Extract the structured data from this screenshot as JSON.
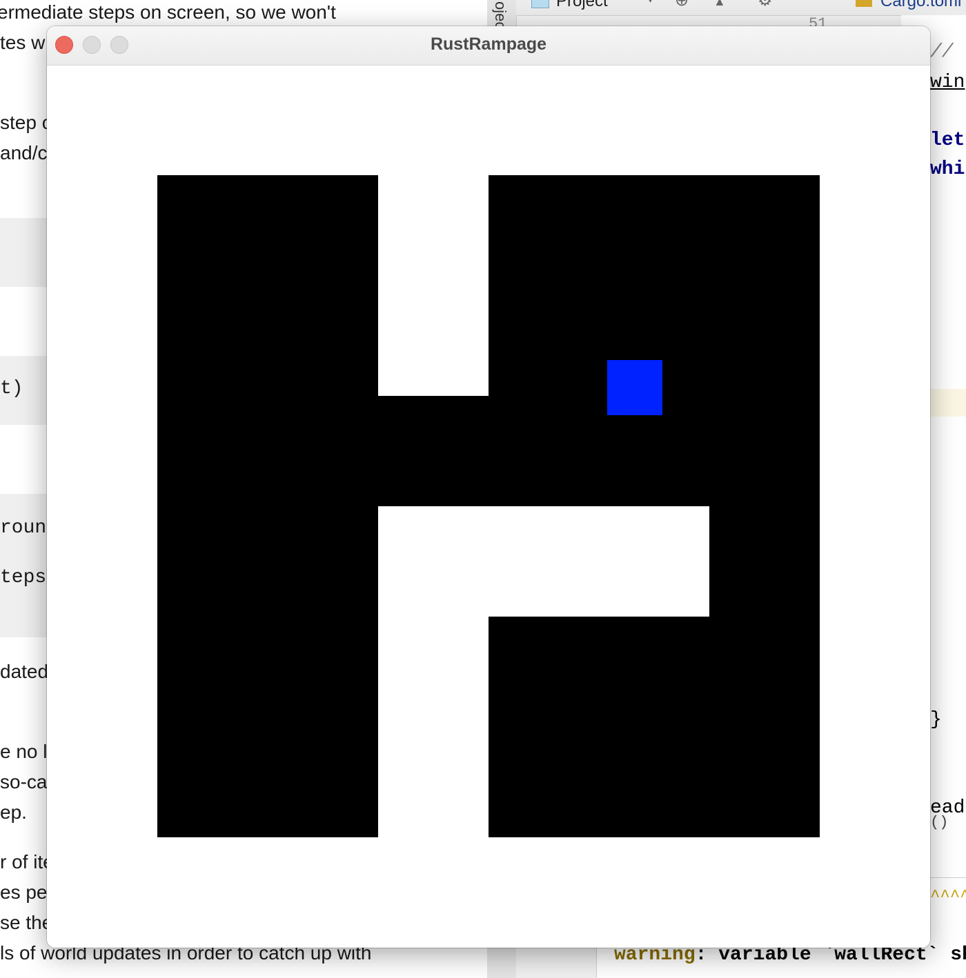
{
  "background_document": {
    "lines": [
      "ermediate steps on screen, so we won't",
      "tes w",
      "step o",
      "and/c",
      "t)",
      "roun",
      "teps",
      "dated",
      "e no l",
      "so-ca",
      "ep.",
      "r of ite",
      "es pe",
      "se the",
      "ls of world updates in order to catch up with"
    ]
  },
  "ide": {
    "sidebar_label": "ojec",
    "toolbar": {
      "project_label": "Project",
      "file_tab": "Cargo.toml",
      "gutter_number": "51"
    },
    "code": {
      "comment": "//",
      "line1": "win",
      "line2": "let",
      "line3": "whi",
      "brace": "}",
      "line4": "ead",
      "line5": "()"
    },
    "console": {
      "carets": "^^^^",
      "warning_label": "warning",
      "warning_text": ": variable `wallRect` sho"
    }
  },
  "app_window": {
    "title": "RustRampage"
  },
  "game": {
    "wall_color": "#000000",
    "player_color": "#0022ff",
    "background_color": "#ffffff"
  }
}
